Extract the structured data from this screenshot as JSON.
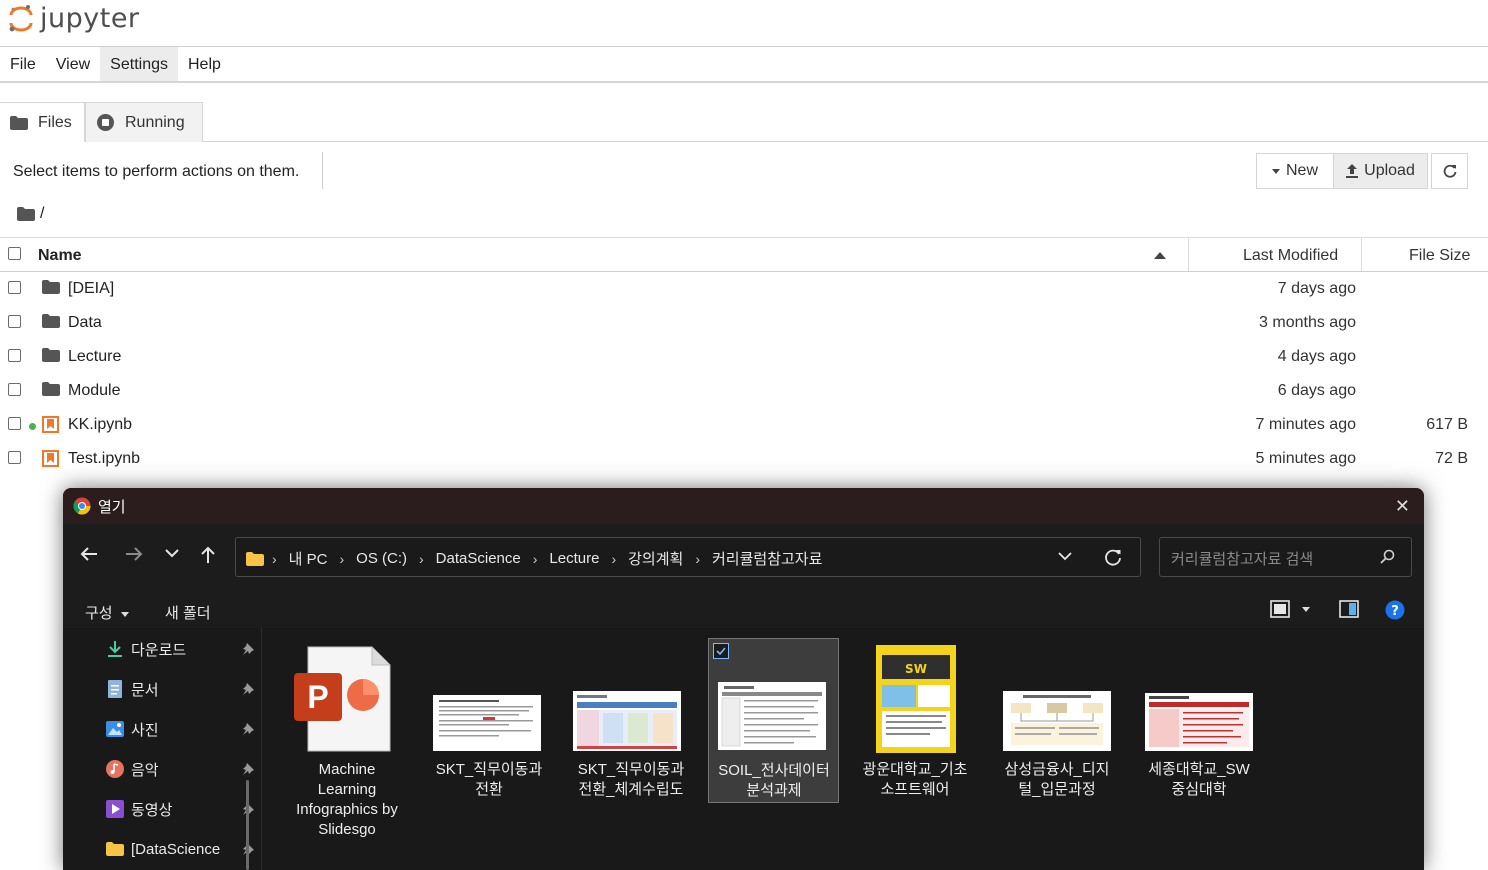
{
  "app": {
    "logo_text": "jupyter"
  },
  "menubar": {
    "items": [
      "File",
      "View",
      "Settings",
      "Help"
    ],
    "active": "Settings"
  },
  "tabs": [
    {
      "label": "Files",
      "icon": "folder-icon"
    },
    {
      "label": "Running",
      "icon": "stop-circle-icon"
    }
  ],
  "toolbar": {
    "hint": "Select items to perform actions on them.",
    "new_label": "New",
    "upload_label": "Upload"
  },
  "breadcrumb": {
    "path": "/"
  },
  "file_list": {
    "headers": {
      "name": "Name",
      "modified": "Last Modified",
      "size": "File Size"
    },
    "rows": [
      {
        "name": "[DEIA]",
        "type": "folder",
        "modified": "7 days ago",
        "size": ""
      },
      {
        "name": "Data",
        "type": "folder",
        "modified": "3 months ago",
        "size": ""
      },
      {
        "name": "Lecture",
        "type": "folder",
        "modified": "4 days ago",
        "size": ""
      },
      {
        "name": "Module",
        "type": "folder",
        "modified": "6 days ago",
        "size": ""
      },
      {
        "name": "KK.ipynb",
        "type": "notebook",
        "running": true,
        "modified": "7 minutes ago",
        "size": "617 B"
      },
      {
        "name": "Test.ipynb",
        "type": "notebook",
        "running": false,
        "modified": "5 minutes ago",
        "size": "72 B"
      }
    ]
  },
  "dialog": {
    "title": "열기",
    "address": [
      "내 PC",
      "OS (C:)",
      "DataScience",
      "Lecture",
      "강의계획",
      "커리큘럼참고자료"
    ],
    "search_placeholder": "커리큘럼참고자료 검색",
    "commands": {
      "organize": "구성",
      "new_folder": "새 폴더"
    },
    "sidebar": [
      {
        "label": "다운로드",
        "icon": "download-icon"
      },
      {
        "label": "문서",
        "icon": "document-icon"
      },
      {
        "label": "사진",
        "icon": "pictures-icon"
      },
      {
        "label": "음악",
        "icon": "music-icon"
      },
      {
        "label": "동영상",
        "icon": "video-icon"
      },
      {
        "label": "[DataScience",
        "icon": "folder-icon"
      }
    ],
    "files": [
      {
        "line1": "Machine",
        "line2": "Learning",
        "line3": "Infographics by",
        "line4": "Slidesgo",
        "kind": "pptx"
      },
      {
        "line1": "SKT_직무이동과",
        "line2": "전환",
        "kind": "doc-thumb"
      },
      {
        "line1": "SKT_직무이동과",
        "line2": "전환_체계수립도",
        "kind": "table-thumb"
      },
      {
        "line1": "SOIL_전사데이터",
        "line2": "분석과제",
        "kind": "doc-thumb",
        "selected": true
      },
      {
        "line1": "광운대학교_기초",
        "line2": "소프트웨어",
        "kind": "poster-thumb"
      },
      {
        "line1": "삼성금융사_디지",
        "line2": "털_입문과정",
        "kind": "chart-thumb"
      },
      {
        "line1": "세종대학교_SW",
        "line2": "중심대학",
        "kind": "red-table-thumb"
      }
    ]
  },
  "colors": {
    "jupyter_orange": "#f37726",
    "dialog_bg": "#202020",
    "accent_blue": "#1a73e8"
  }
}
